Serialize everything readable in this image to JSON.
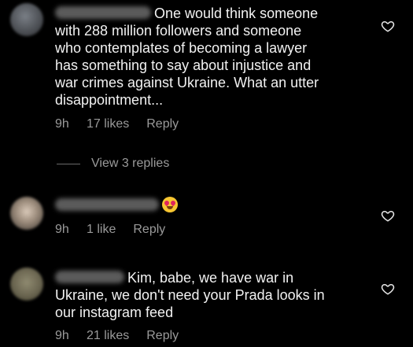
{
  "comments": [
    {
      "text": "One would think someone\nwith 288 million followers and someone\nwho contemplates of becoming a lawyer\nhas something to say about injustice and\nwar crimes against Ukraine. What an utter\ndisappointment...",
      "time": "9h",
      "likes": "17 likes",
      "reply": "Reply",
      "view_replies": "View 3 replies",
      "heart_icon": "heart-outline-icon"
    },
    {
      "text": "",
      "emoji": "heart-eyes-emoji-icon",
      "time": "9h",
      "likes": "1 like",
      "reply": "Reply",
      "heart_icon": "heart-outline-icon"
    },
    {
      "text": "Kim, babe, we have war in\nUkraine, we don't need your Prada looks in\nour instagram feed",
      "time": "9h",
      "likes": "21 likes",
      "reply": "Reply",
      "heart_icon": "heart-outline-icon"
    }
  ],
  "colors": {
    "background": "#000000",
    "text": "#f2f2f2",
    "muted": "#9a9a9a"
  }
}
